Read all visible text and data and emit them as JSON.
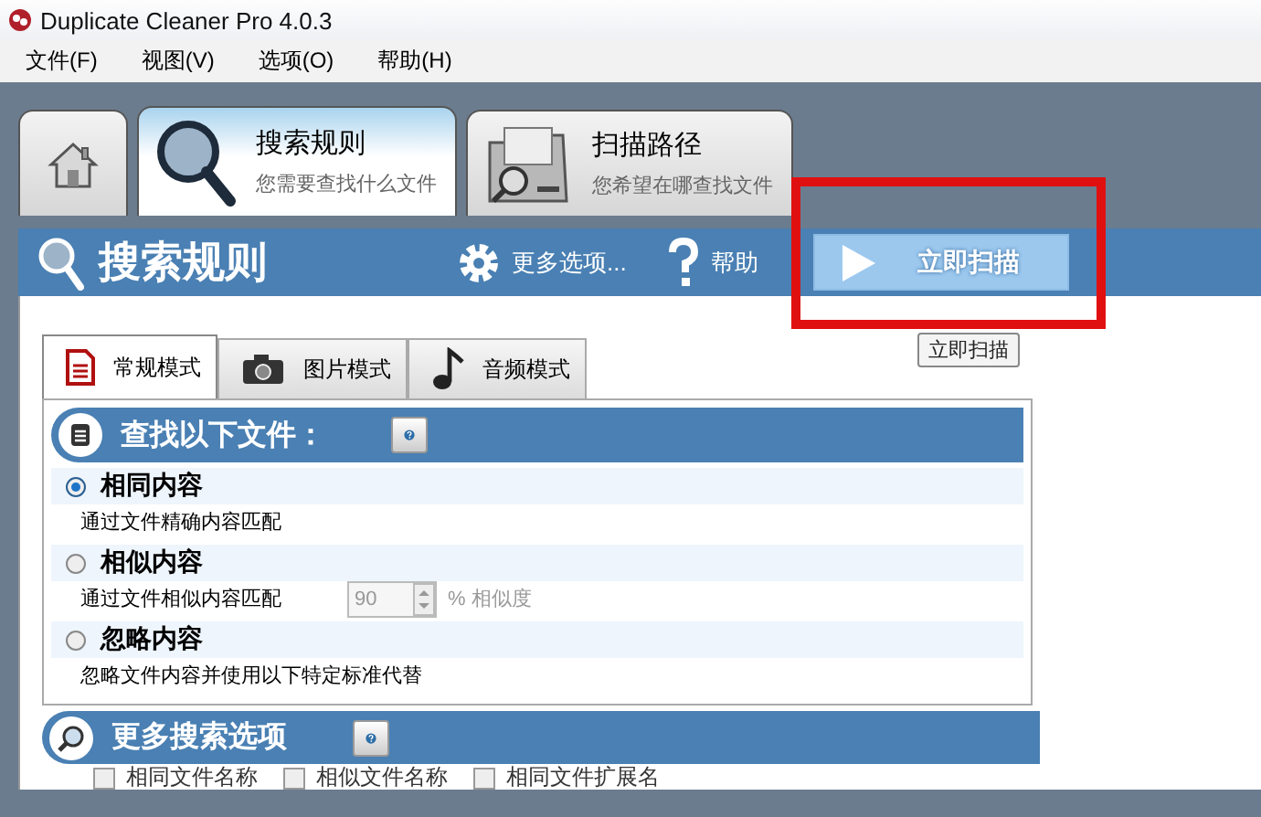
{
  "window": {
    "title": "Duplicate Cleaner Pro 4.0.3"
  },
  "menu": [
    "文件(F)",
    "视图(V)",
    "选项(O)",
    "帮助(H)"
  ],
  "main_tabs": [
    {
      "kind": "home",
      "selected": false
    },
    {
      "kind": "search",
      "title": "搜索规则",
      "subtitle": "您需要查找什么文件",
      "selected": true
    },
    {
      "kind": "folder",
      "title": "扫描路径",
      "subtitle": "您希望在哪查找文件",
      "selected": false
    }
  ],
  "toolbar": {
    "title": "搜索规则",
    "more_options": "更多选项...",
    "help": "帮助",
    "scan_button": "立即扫描",
    "scan_highlighted": true,
    "tooltip": "立即扫描"
  },
  "mode_tabs": [
    {
      "kind": "document",
      "label": "常规模式",
      "selected": true
    },
    {
      "kind": "camera",
      "label": "图片模式",
      "selected": false
    },
    {
      "kind": "music",
      "label": "音频模式",
      "selected": false
    }
  ],
  "find_section": {
    "title": "查找以下文件：",
    "options": [
      {
        "label": "相同内容",
        "description": "通过文件精确内容匹配",
        "selected": true
      },
      {
        "label": "相似内容",
        "description": "通过文件相似内容匹配",
        "selected": false,
        "similarity": {
          "value": "90",
          "unit": "% 相似度",
          "disabled": true
        }
      },
      {
        "label": "忽略内容",
        "description": "忽略文件内容并使用以下特定标准代替",
        "selected": false
      }
    ]
  },
  "more_section": {
    "title": "更多搜索选项",
    "checkboxes": [
      {
        "label": "相同文件名称",
        "checked": false
      },
      {
        "label": "相似文件名称",
        "checked": false
      },
      {
        "label": "相同文件扩展名",
        "checked": false
      }
    ]
  }
}
